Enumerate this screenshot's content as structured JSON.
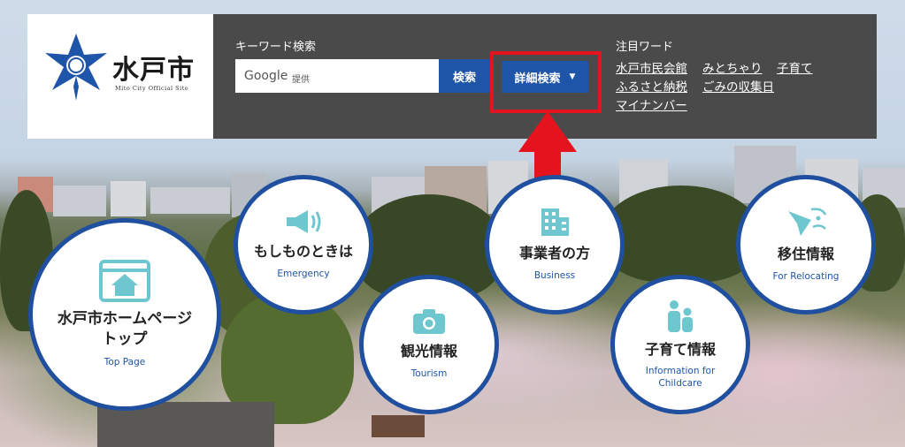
{
  "logo": {
    "title": "水戸市",
    "subtitle": "Mito City Official Site"
  },
  "search": {
    "label": "キーワード検索",
    "google": "Google",
    "provided": "提供",
    "button": "検索",
    "advanced": "詳細検索",
    "caret": "▼"
  },
  "hot": {
    "label": "注目ワード",
    "links": [
      "水戸市民会館",
      "みとちゃり",
      "子育て",
      "ふるさと納税",
      "ごみの収集日",
      "マイナンバー"
    ]
  },
  "nav": {
    "top": {
      "title_line1": "水戸市ホームページ",
      "title_line2": "トップ",
      "sub": "Top Page",
      "icon": "home-icon"
    },
    "emergency": {
      "title": "もしものときは",
      "sub": "Emergency",
      "icon": "megaphone-icon"
    },
    "tourism": {
      "title": "観光情報",
      "sub": "Tourism",
      "icon": "camera-icon"
    },
    "business": {
      "title": "事業者の方",
      "sub": "Business",
      "icon": "building-icon"
    },
    "childcare": {
      "title": "子育て情報",
      "sub_line1": "Information for",
      "sub_line2": "Childcare",
      "icon": "family-icon"
    },
    "relocating": {
      "title": "移住情報",
      "sub": "For Relocating",
      "icon": "paper-plane-icon"
    }
  },
  "colors": {
    "accent": "#1f55a8",
    "ring": "#1f4f9e",
    "highlight": "#e4131d",
    "header": "#4a4a4a",
    "icon": "#6ec6cf"
  }
}
